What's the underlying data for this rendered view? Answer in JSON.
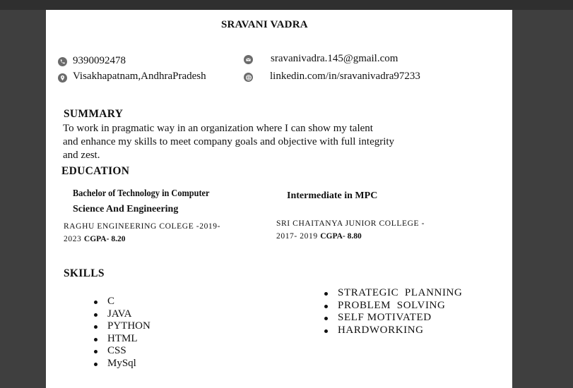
{
  "header": {
    "name": "SRAVANI VADRA"
  },
  "contact": {
    "phone": "9390092478",
    "location": "Visakhapatnam,AndhraPradesh",
    "email": "sravanivadra.145@gmail.com",
    "linkedin": "linkedin.com/in/sravanivadra97233",
    "icons": {
      "phone": "phone-icon",
      "location": "location-pin-icon",
      "email": "envelope-icon",
      "linkedin": "globe-icon"
    }
  },
  "summary": {
    "heading": "SUMMARY",
    "lines": [
      "To work in pragmatic way in an organization where I can show my talent",
      "and enhance my skills to meet company goals and objective with full integrity",
      "and zest."
    ]
  },
  "education": {
    "heading": "EDUCATION",
    "degree1": {
      "line1": "Bachelor of Technology in Computer",
      "line2": "Science And Engineering",
      "institution": "RAGHU ENGINEERING COLEGE -2019-",
      "years": "2023",
      "cgpa_label": "CGPA- ",
      "cgpa": "8.20"
    },
    "degree2": {
      "title": "Intermediate in MPC",
      "institution": "SRI CHAITANYA JUNIOR COLLEGE -",
      "years": "2017- 2019",
      "cgpa_label": "CGPA- ",
      "cgpa": "8.80"
    }
  },
  "skills": {
    "heading": "SKILLS",
    "technical": [
      "C",
      "JAVA",
      "PYTHON",
      "HTML",
      "CSS",
      "MySql"
    ],
    "soft": [
      "STRATEGIC  PLANNING",
      "PROBLEM  SOLVING",
      "SELF MOTIVATED",
      "HARDWORKING"
    ]
  },
  "colors": {
    "viewer_background": "#3f3f3f",
    "page": "#ffffff",
    "icon": "#6b6b6b"
  }
}
